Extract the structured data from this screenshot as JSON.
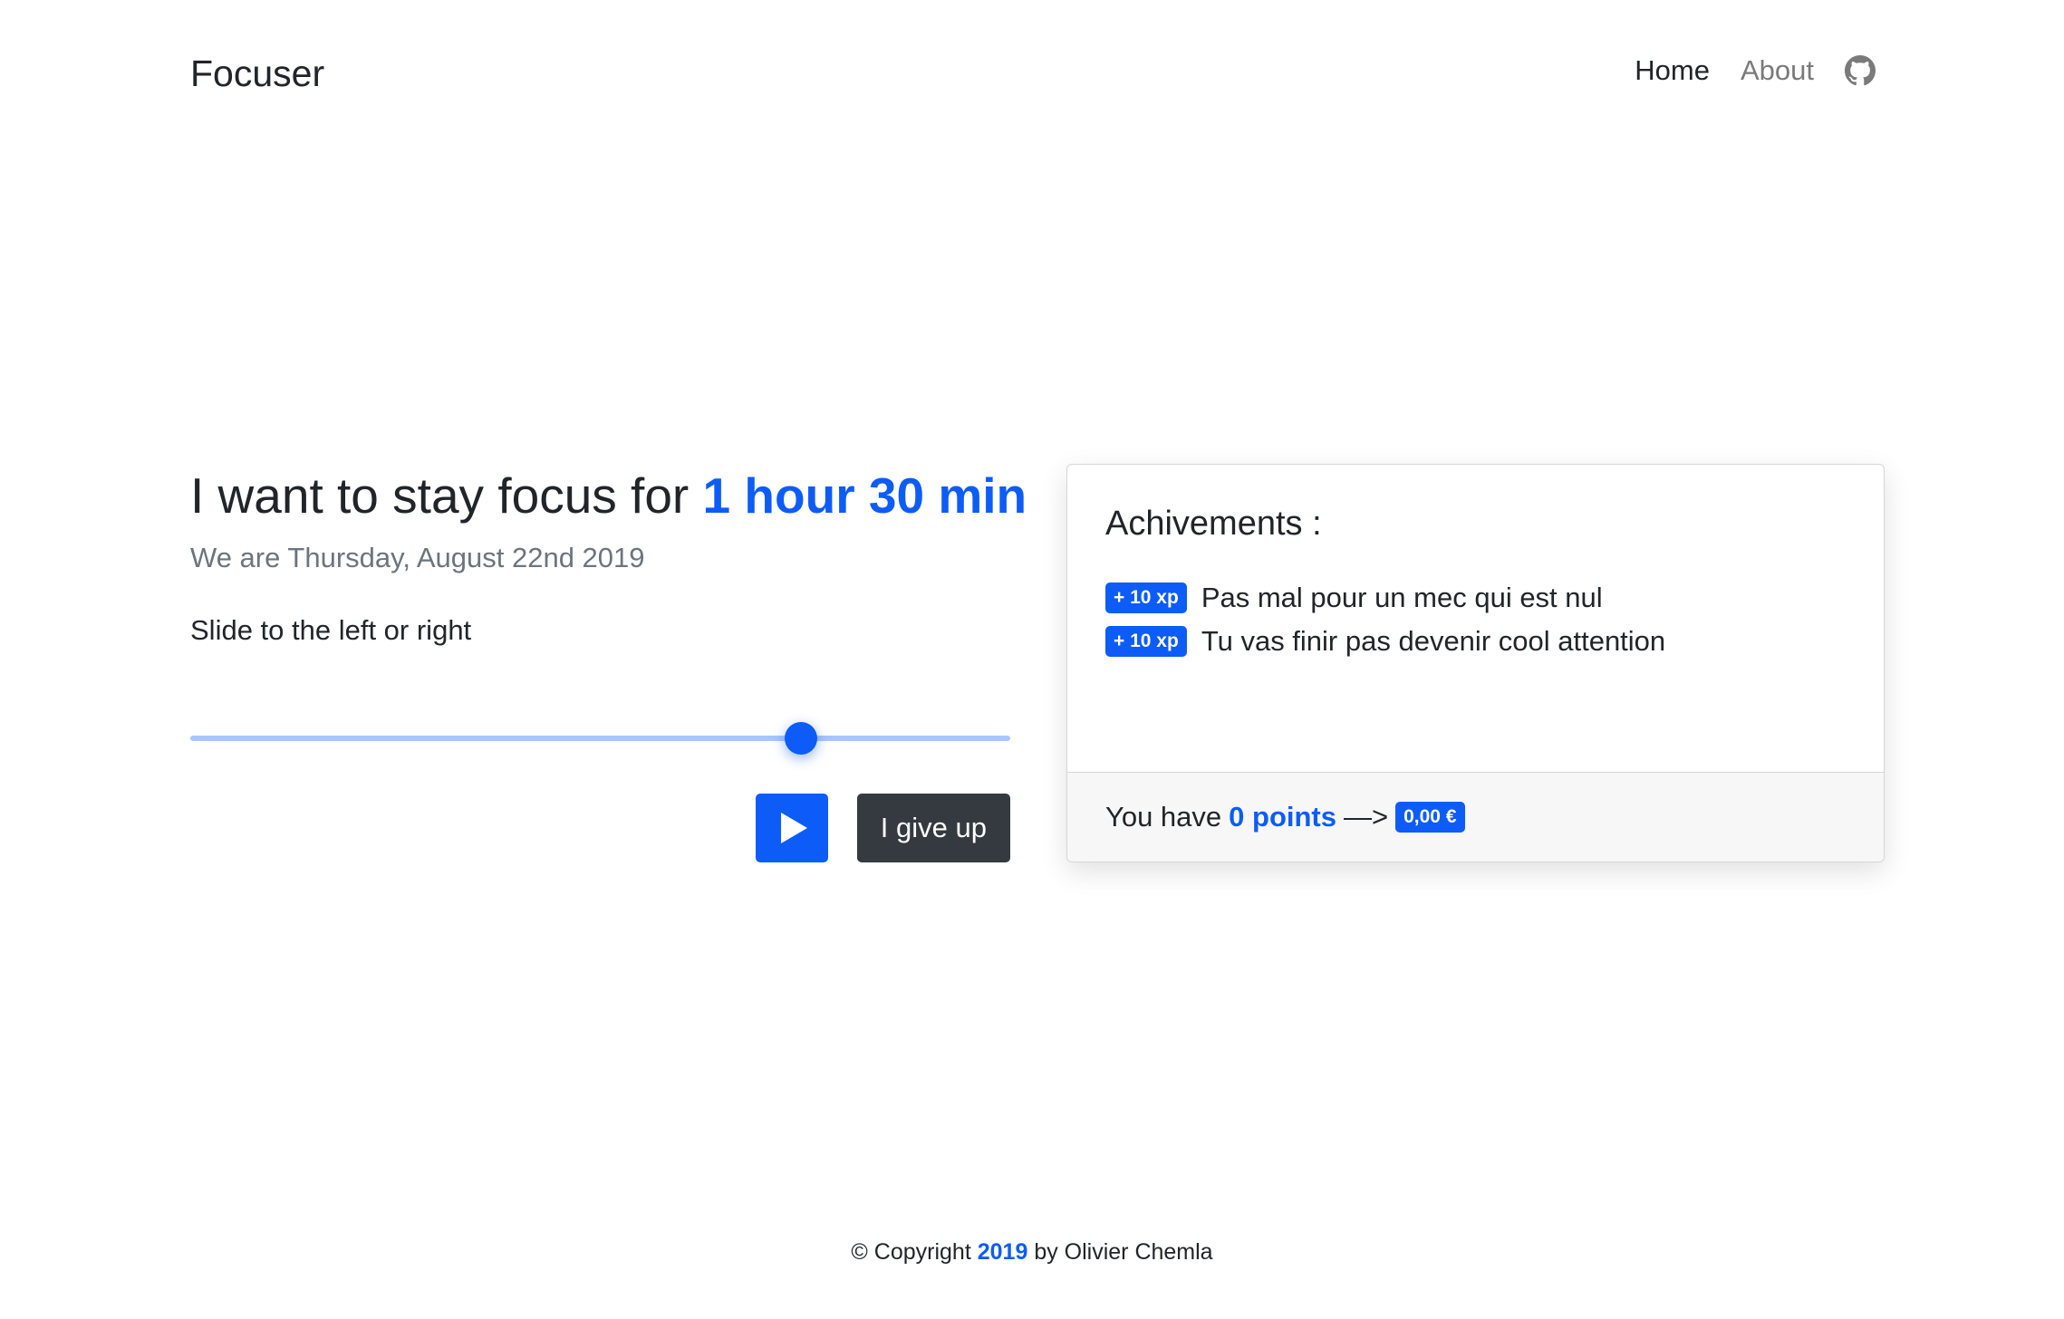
{
  "navbar": {
    "brand": "Focuser",
    "links": [
      {
        "label": "Home",
        "active": true
      },
      {
        "label": "About",
        "active": false
      }
    ],
    "github_icon": "github-icon"
  },
  "main": {
    "headline_prefix": "I want to stay focus for",
    "duration": "1 hour 30 min",
    "date_text": "We are Thursday, August 22nd 2019",
    "slider_hint": "Slide to the left or right",
    "slider_value_fraction": 0.745,
    "play_icon": "play-icon",
    "give_up_label": "I give up"
  },
  "achievements": {
    "title": "Achivements :",
    "items": [
      {
        "badge": "+ 10 xp",
        "text": "Pas mal pour un mec qui est nul"
      },
      {
        "badge": "+ 10 xp",
        "text": "Tu vas finir pas devenir cool attention"
      }
    ],
    "footer": {
      "prefix": "You have",
      "points": "0 points",
      "arrow": "—>",
      "money": "0,00 €"
    }
  },
  "footer": {
    "prefix": "© Copyright",
    "year": "2019",
    "suffix": "by Olivier Chemla"
  },
  "colors": {
    "accent": "#0d5cf7",
    "dark_button": "#343a40",
    "muted_text": "#6c757d"
  }
}
